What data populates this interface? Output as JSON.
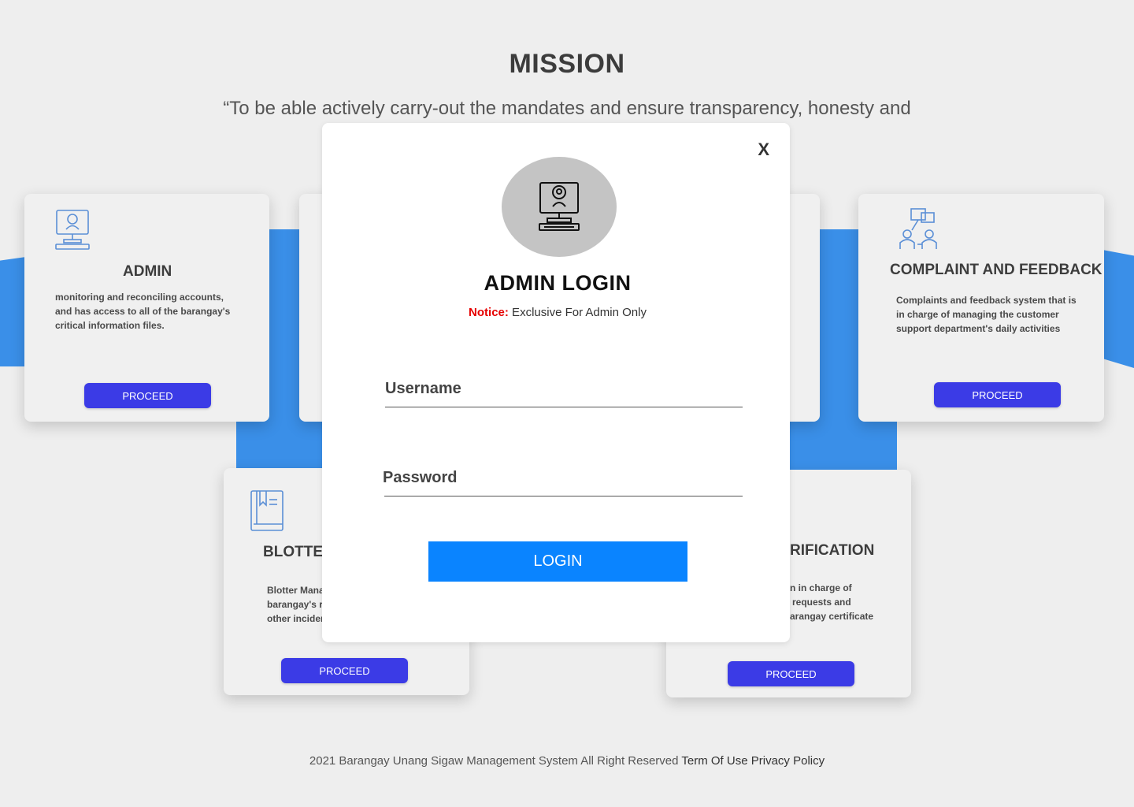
{
  "mission": {
    "title": "MISSION",
    "quote": "“To be able actively carry-out the mandates and ensure transparency, honesty and"
  },
  "cards": {
    "admin": {
      "title": "ADMIN",
      "desc_lines": [
        "monitoring and reconciling accounts,",
        "and has access to all of the barangay's",
        "critical information files."
      ],
      "button": "PROCEED",
      "icon": "computer-user-icon"
    },
    "complaint": {
      "title": "COMPLAINT AND FEEDBACK",
      "desc_lines": [
        "Complaints and feedback system that is",
        "in charge of managing the customer",
        "support department's daily activities"
      ],
      "button": "PROCEED",
      "icon": "feedback-people-icon"
    },
    "blotter": {
      "title": "BLOTTER",
      "desc_lines": [
        "Blotter Mana",
        "barangay's r",
        "other incider"
      ],
      "button": "PROCEED",
      "icon": "book-icon"
    },
    "verification": {
      "title": "RIFICATION",
      "desc_lines": [
        "n in charge of",
        "requests and",
        "arangay certificate"
      ],
      "button": "PROCEED"
    }
  },
  "modal": {
    "close": "X",
    "title": "ADMIN LOGIN",
    "notice_label": "Notice:",
    "notice_text": " Exclusive For Admin Only",
    "username_label": "Username",
    "password_label": "Password",
    "login_button": "LOGIN",
    "avatar_icon": "computer-user-icon"
  },
  "footer": {
    "text": "2021 Barangay Unang Sigaw Management System All Right Reserved ",
    "terms": "Term Of Use",
    "privacy": "Privacy Policy"
  },
  "colors": {
    "accent_blue": "#3a8fe8",
    "proceed_button": "#3b3be6",
    "login_button": "#0a84ff",
    "notice_red": "#e60000"
  }
}
